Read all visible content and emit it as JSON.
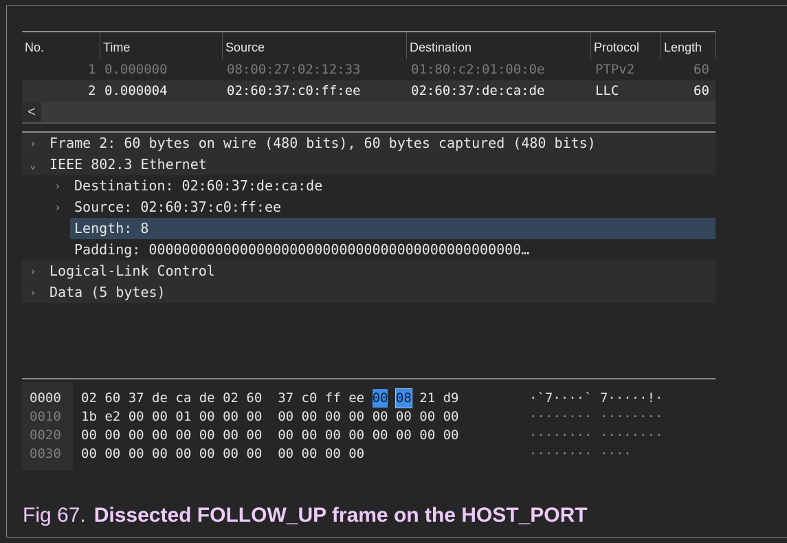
{
  "packet_list": {
    "columns": [
      "No.",
      "Time",
      "Source",
      "Destination",
      "Protocol",
      "Length"
    ],
    "rows": [
      {
        "no": "1",
        "time": "0.000000",
        "source": "08:00:27:02:12:33",
        "destination": "01:80:c2:01:00:0e",
        "protocol": "PTPv2",
        "length": "60"
      },
      {
        "no": "2",
        "time": "0.000004",
        "source": "02:60:37:c0:ff:ee",
        "destination": "02:60:37:de:ca:de",
        "protocol": "LLC",
        "length": "60"
      }
    ],
    "scroll_left_glyph": "<"
  },
  "details": {
    "items": [
      {
        "text": "Frame 2: 60 bytes on wire (480 bits), 60 bytes captured (480 bits)",
        "expander": ">"
      },
      {
        "text": "IEEE 802.3 Ethernet",
        "expander": "v"
      },
      {
        "text": "Destination: 02:60:37:de:ca:de",
        "expander": ">"
      },
      {
        "text": "Source: 02:60:37:c0:ff:ee",
        "expander": ">"
      },
      {
        "text": "Length: 8",
        "expander": ""
      },
      {
        "text": "Padding: 000000000000000000000000000000000000000000000…",
        "expander": ""
      },
      {
        "text": "Logical-Link Control",
        "expander": ">"
      },
      {
        "text": "Data (5 bytes)",
        "expander": ">"
      }
    ]
  },
  "hex": {
    "rows": [
      {
        "offset": "0000",
        "bytes1": [
          "02",
          "60",
          "37",
          "de",
          "ca",
          "de",
          "02",
          "60"
        ],
        "bytes2": [
          "37",
          "c0",
          "ff",
          "ee",
          "00",
          "08",
          "21",
          "d9"
        ],
        "ascii1": "·`7····`",
        "ascii2": " 7·····!·"
      },
      {
        "offset": "0010",
        "bytes1": [
          "1b",
          "e2",
          "00",
          "00",
          "01",
          "00",
          "00",
          "00"
        ],
        "bytes2": [
          "00",
          "00",
          "00",
          "00",
          "00",
          "00",
          "00",
          "00"
        ],
        "ascii1": "········",
        "ascii2": " ········"
      },
      {
        "offset": "0020",
        "bytes1": [
          "00",
          "00",
          "00",
          "00",
          "00",
          "00",
          "00",
          "00"
        ],
        "bytes2": [
          "00",
          "00",
          "00",
          "00",
          "00",
          "00",
          "00",
          "00"
        ],
        "ascii1": "········",
        "ascii2": " ········"
      },
      {
        "offset": "0030",
        "bytes1": [
          "00",
          "00",
          "00",
          "00",
          "00",
          "00",
          "00",
          "00"
        ],
        "bytes2": [
          "00",
          "00",
          "00",
          "00"
        ],
        "ascii1": "········",
        "ascii2": " ····"
      }
    ],
    "highlight": {
      "row": 0,
      "group": 2,
      "indices": [
        4,
        5
      ]
    }
  },
  "caption": {
    "number": "Fig 67.",
    "title": "Dissected FOLLOW_UP frame on the HOST_PORT"
  },
  "colors": {
    "background": "#262626",
    "selection": "#34465a",
    "byte_highlight": "#3d8ee6",
    "caption": "#eecaff"
  }
}
